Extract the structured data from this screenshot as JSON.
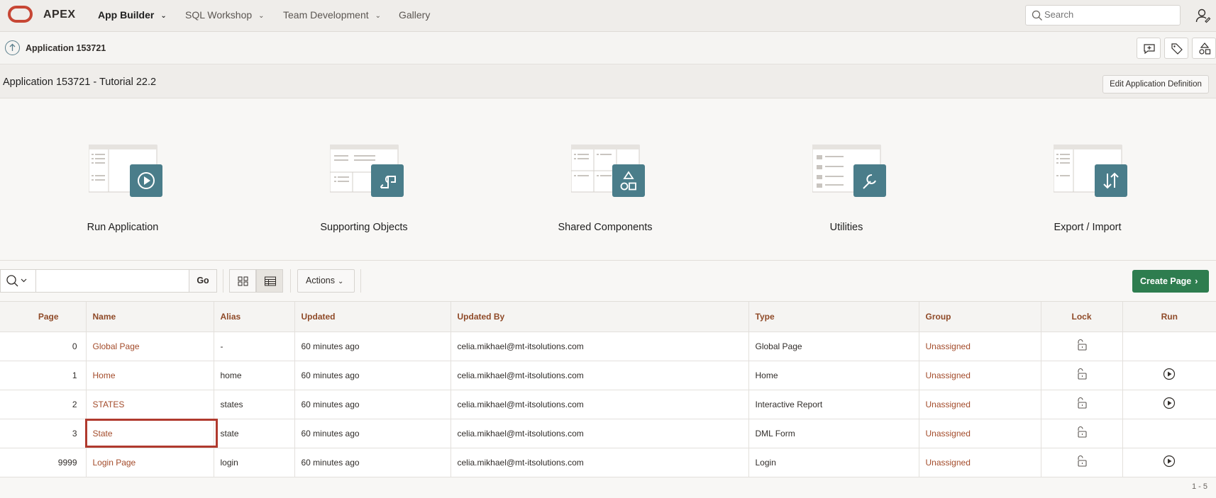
{
  "topnav": {
    "brand": "APEX",
    "items": [
      {
        "label": "App Builder",
        "dropdown": true
      },
      {
        "label": "SQL Workshop",
        "dropdown": true
      },
      {
        "label": "Team Development",
        "dropdown": true
      },
      {
        "label": "Gallery",
        "dropdown": false
      }
    ],
    "search_placeholder": "Search"
  },
  "breadcrumb": {
    "label": "Application 153721"
  },
  "title": {
    "text": "Application 153721 - Tutorial 22.2",
    "edit_label": "Edit Application Definition"
  },
  "tiles": [
    {
      "label": "Run Application",
      "icon": "play-icon"
    },
    {
      "label": "Supporting Objects",
      "icon": "scroll-icon"
    },
    {
      "label": "Shared Components",
      "icon": "shapes-icon"
    },
    {
      "label": "Utilities",
      "icon": "wrench-icon"
    },
    {
      "label": "Export / Import",
      "icon": "up-down-arrows-icon"
    }
  ],
  "toolbar": {
    "go_label": "Go",
    "actions_label": "Actions",
    "create_label": "Create Page"
  },
  "table": {
    "headers": [
      "Page",
      "Name",
      "Alias",
      "Updated",
      "Updated By",
      "Type",
      "Group",
      "Lock",
      "Run"
    ],
    "rows": [
      {
        "page": "0",
        "name": "Global Page",
        "alias": "-",
        "updated": "60 minutes ago",
        "updated_by": "celia.mikhael@mt-itsolutions.com",
        "type": "Global Page",
        "group": "Unassigned",
        "run": false
      },
      {
        "page": "1",
        "name": "Home",
        "alias": "home",
        "updated": "60 minutes ago",
        "updated_by": "celia.mikhael@mt-itsolutions.com",
        "type": "Home",
        "group": "Unassigned",
        "run": true
      },
      {
        "page": "2",
        "name": "STATES",
        "alias": "states",
        "updated": "60 minutes ago",
        "updated_by": "celia.mikhael@mt-itsolutions.com",
        "type": "Interactive Report",
        "group": "Unassigned",
        "run": true
      },
      {
        "page": "3",
        "name": "State",
        "alias": "state",
        "updated": "60 minutes ago",
        "updated_by": "celia.mikhael@mt-itsolutions.com",
        "type": "DML Form",
        "group": "Unassigned",
        "run": false
      },
      {
        "page": "9999",
        "name": "Login Page",
        "alias": "login",
        "updated": "60 minutes ago",
        "updated_by": "celia.mikhael@mt-itsolutions.com",
        "type": "Login",
        "group": "Unassigned",
        "run": true
      }
    ],
    "pagination": "1 - 5"
  },
  "colors": {
    "accent": "#4a7d8a",
    "link": "#a34b2a",
    "create": "#2e7d4f",
    "highlight": "#b03a2e"
  }
}
